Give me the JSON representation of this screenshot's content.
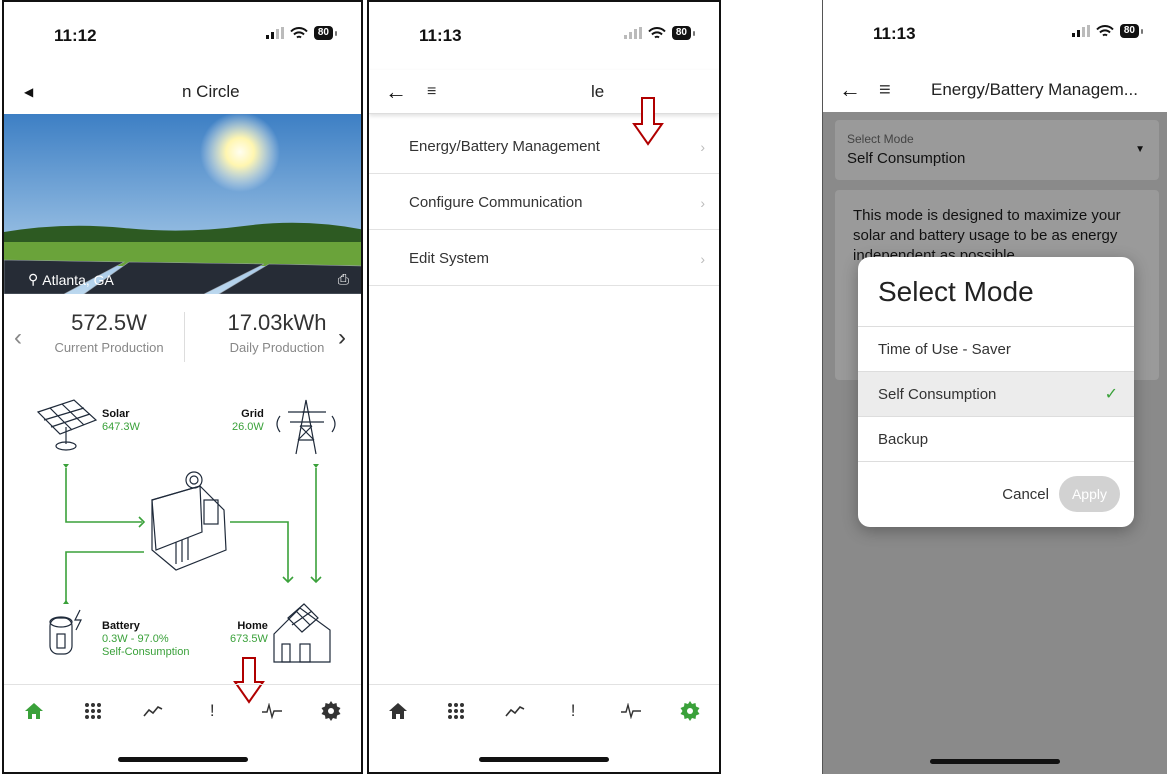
{
  "screen1": {
    "time": "11:12",
    "battery": "80",
    "title": "n Circle",
    "location": "Atlanta, GA",
    "current_production_value": "572.5W",
    "current_production_label": "Current Production",
    "daily_production_value": "17.03kWh",
    "daily_production_label": "Daily Production",
    "solar": {
      "label": "Solar",
      "value": "647.3W"
    },
    "grid": {
      "label": "Grid",
      "value": "26.0W"
    },
    "battery_node": {
      "label": "Battery",
      "value": "0.3W - 97.0%",
      "mode": "Self-Consumption"
    },
    "home": {
      "label": "Home",
      "value": "673.5W"
    },
    "tabs": [
      "home-icon",
      "grid-apps-icon",
      "trend-chart-icon",
      "alert-icon",
      "pulse-icon",
      "gear-icon"
    ],
    "active_tab": "home-icon"
  },
  "screen2": {
    "time": "11:13",
    "battery": "80",
    "title": "le",
    "menu": [
      "Energy/Battery Management",
      "Configure Communication",
      "Edit System"
    ],
    "active_tab": "gear-icon"
  },
  "screen3": {
    "time": "11:13",
    "battery": "80",
    "title": "Energy/Battery Managem...",
    "select_label": "Select Mode",
    "select_value": "Self Consumption",
    "description": "This mode is designed to maximize your solar and battery usage to be as energy independent as possible.",
    "modal_title": "Select Mode",
    "options": [
      "Time of Use - Saver",
      "Self Consumption",
      "Backup"
    ],
    "selected_option": "Self Consumption",
    "cancel_label": "Cancel",
    "apply_label": "Apply"
  },
  "colors": {
    "accent_green": "#3aa13a",
    "annotation_red": "#b00000"
  }
}
